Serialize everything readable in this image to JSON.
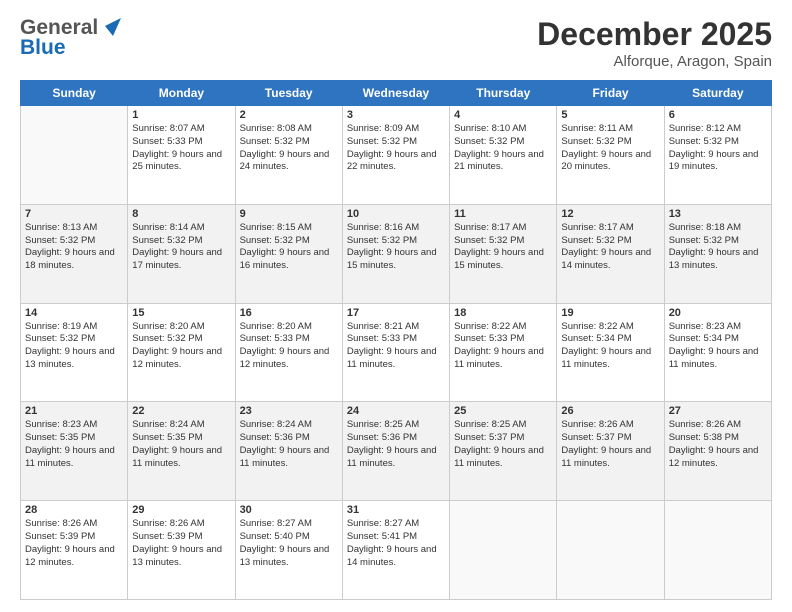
{
  "header": {
    "logo_general": "General",
    "logo_blue": "Blue",
    "month": "December 2025",
    "location": "Alforque, Aragon, Spain"
  },
  "weekdays": [
    "Sunday",
    "Monday",
    "Tuesday",
    "Wednesday",
    "Thursday",
    "Friday",
    "Saturday"
  ],
  "weeks": [
    [
      {
        "day": "",
        "empty": true
      },
      {
        "day": "1",
        "sunrise": "Sunrise: 8:07 AM",
        "sunset": "Sunset: 5:33 PM",
        "daylight": "Daylight: 9 hours and 25 minutes."
      },
      {
        "day": "2",
        "sunrise": "Sunrise: 8:08 AM",
        "sunset": "Sunset: 5:32 PM",
        "daylight": "Daylight: 9 hours and 24 minutes."
      },
      {
        "day": "3",
        "sunrise": "Sunrise: 8:09 AM",
        "sunset": "Sunset: 5:32 PM",
        "daylight": "Daylight: 9 hours and 22 minutes."
      },
      {
        "day": "4",
        "sunrise": "Sunrise: 8:10 AM",
        "sunset": "Sunset: 5:32 PM",
        "daylight": "Daylight: 9 hours and 21 minutes."
      },
      {
        "day": "5",
        "sunrise": "Sunrise: 8:11 AM",
        "sunset": "Sunset: 5:32 PM",
        "daylight": "Daylight: 9 hours and 20 minutes."
      },
      {
        "day": "6",
        "sunrise": "Sunrise: 8:12 AM",
        "sunset": "Sunset: 5:32 PM",
        "daylight": "Daylight: 9 hours and 19 minutes."
      }
    ],
    [
      {
        "day": "7",
        "sunrise": "Sunrise: 8:13 AM",
        "sunset": "Sunset: 5:32 PM",
        "daylight": "Daylight: 9 hours and 18 minutes."
      },
      {
        "day": "8",
        "sunrise": "Sunrise: 8:14 AM",
        "sunset": "Sunset: 5:32 PM",
        "daylight": "Daylight: 9 hours and 17 minutes."
      },
      {
        "day": "9",
        "sunrise": "Sunrise: 8:15 AM",
        "sunset": "Sunset: 5:32 PM",
        "daylight": "Daylight: 9 hours and 16 minutes."
      },
      {
        "day": "10",
        "sunrise": "Sunrise: 8:16 AM",
        "sunset": "Sunset: 5:32 PM",
        "daylight": "Daylight: 9 hours and 15 minutes."
      },
      {
        "day": "11",
        "sunrise": "Sunrise: 8:17 AM",
        "sunset": "Sunset: 5:32 PM",
        "daylight": "Daylight: 9 hours and 15 minutes."
      },
      {
        "day": "12",
        "sunrise": "Sunrise: 8:17 AM",
        "sunset": "Sunset: 5:32 PM",
        "daylight": "Daylight: 9 hours and 14 minutes."
      },
      {
        "day": "13",
        "sunrise": "Sunrise: 8:18 AM",
        "sunset": "Sunset: 5:32 PM",
        "daylight": "Daylight: 9 hours and 13 minutes."
      }
    ],
    [
      {
        "day": "14",
        "sunrise": "Sunrise: 8:19 AM",
        "sunset": "Sunset: 5:32 PM",
        "daylight": "Daylight: 9 hours and 13 minutes."
      },
      {
        "day": "15",
        "sunrise": "Sunrise: 8:20 AM",
        "sunset": "Sunset: 5:32 PM",
        "daylight": "Daylight: 9 hours and 12 minutes."
      },
      {
        "day": "16",
        "sunrise": "Sunrise: 8:20 AM",
        "sunset": "Sunset: 5:33 PM",
        "daylight": "Daylight: 9 hours and 12 minutes."
      },
      {
        "day": "17",
        "sunrise": "Sunrise: 8:21 AM",
        "sunset": "Sunset: 5:33 PM",
        "daylight": "Daylight: 9 hours and 11 minutes."
      },
      {
        "day": "18",
        "sunrise": "Sunrise: 8:22 AM",
        "sunset": "Sunset: 5:33 PM",
        "daylight": "Daylight: 9 hours and 11 minutes."
      },
      {
        "day": "19",
        "sunrise": "Sunrise: 8:22 AM",
        "sunset": "Sunset: 5:34 PM",
        "daylight": "Daylight: 9 hours and 11 minutes."
      },
      {
        "day": "20",
        "sunrise": "Sunrise: 8:23 AM",
        "sunset": "Sunset: 5:34 PM",
        "daylight": "Daylight: 9 hours and 11 minutes."
      }
    ],
    [
      {
        "day": "21",
        "sunrise": "Sunrise: 8:23 AM",
        "sunset": "Sunset: 5:35 PM",
        "daylight": "Daylight: 9 hours and 11 minutes."
      },
      {
        "day": "22",
        "sunrise": "Sunrise: 8:24 AM",
        "sunset": "Sunset: 5:35 PM",
        "daylight": "Daylight: 9 hours and 11 minutes."
      },
      {
        "day": "23",
        "sunrise": "Sunrise: 8:24 AM",
        "sunset": "Sunset: 5:36 PM",
        "daylight": "Daylight: 9 hours and 11 minutes."
      },
      {
        "day": "24",
        "sunrise": "Sunrise: 8:25 AM",
        "sunset": "Sunset: 5:36 PM",
        "daylight": "Daylight: 9 hours and 11 minutes."
      },
      {
        "day": "25",
        "sunrise": "Sunrise: 8:25 AM",
        "sunset": "Sunset: 5:37 PM",
        "daylight": "Daylight: 9 hours and 11 minutes."
      },
      {
        "day": "26",
        "sunrise": "Sunrise: 8:26 AM",
        "sunset": "Sunset: 5:37 PM",
        "daylight": "Daylight: 9 hours and 11 minutes."
      },
      {
        "day": "27",
        "sunrise": "Sunrise: 8:26 AM",
        "sunset": "Sunset: 5:38 PM",
        "daylight": "Daylight: 9 hours and 12 minutes."
      }
    ],
    [
      {
        "day": "28",
        "sunrise": "Sunrise: 8:26 AM",
        "sunset": "Sunset: 5:39 PM",
        "daylight": "Daylight: 9 hours and 12 minutes."
      },
      {
        "day": "29",
        "sunrise": "Sunrise: 8:26 AM",
        "sunset": "Sunset: 5:39 PM",
        "daylight": "Daylight: 9 hours and 13 minutes."
      },
      {
        "day": "30",
        "sunrise": "Sunrise: 8:27 AM",
        "sunset": "Sunset: 5:40 PM",
        "daylight": "Daylight: 9 hours and 13 minutes."
      },
      {
        "day": "31",
        "sunrise": "Sunrise: 8:27 AM",
        "sunset": "Sunset: 5:41 PM",
        "daylight": "Daylight: 9 hours and 14 minutes."
      },
      {
        "day": "",
        "empty": true
      },
      {
        "day": "",
        "empty": true
      },
      {
        "day": "",
        "empty": true
      }
    ]
  ]
}
